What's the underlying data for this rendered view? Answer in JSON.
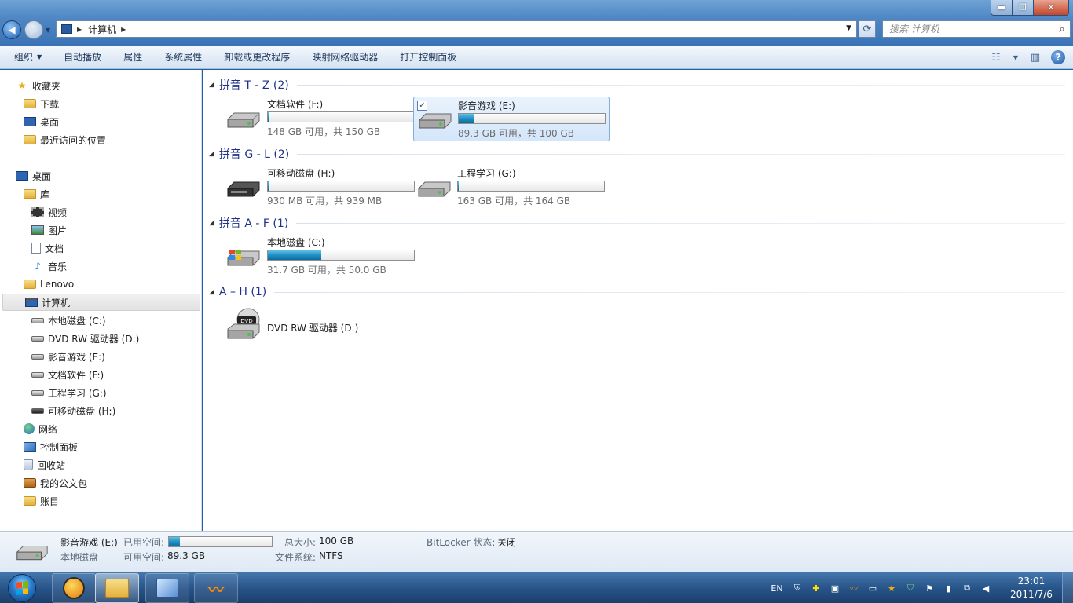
{
  "window": {
    "title_buttons": {
      "minimize": "▬",
      "maximize": "❐",
      "close": "✕"
    }
  },
  "address": {
    "crumb": "计算机"
  },
  "search": {
    "placeholder": "搜索 计算机"
  },
  "toolbar": {
    "organize": "组织",
    "autoplay": "自动播放",
    "properties": "属性",
    "system_properties": "系统属性",
    "uninstall": "卸载或更改程序",
    "map_drive": "映射网络驱动器",
    "control_panel": "打开控制面板"
  },
  "nav": {
    "favorites": "收藏夹",
    "downloads": "下载",
    "desktop_fav": "桌面",
    "recent": "最近访问的位置",
    "desktop": "桌面",
    "libraries": "库",
    "videos": "视频",
    "pictures": "图片",
    "documents": "文档",
    "music": "音乐",
    "lenovo": "Lenovo",
    "computer": "计算机",
    "drive_c": "本地磁盘 (C:)",
    "drive_d": "DVD RW 驱动器 (D:)",
    "drive_e": "影音游戏 (E:)",
    "drive_f": "文档软件 (F:)",
    "drive_g": "工程学习 (G:)",
    "drive_h": "可移动磁盘 (H:)",
    "network": "网络",
    "control_panel": "控制面板",
    "recycle_bin": "回收站",
    "briefcase": "我的公文包",
    "ledger": "账目"
  },
  "groups": [
    {
      "title": "拼音 T - Z (2)"
    },
    {
      "title": "拼音 G - L (2)"
    },
    {
      "title": "拼音 A - F (1)"
    },
    {
      "title": "A – H (1)"
    }
  ],
  "drives": {
    "f": {
      "name": "文档软件 (F:)",
      "space": "148 GB 可用，共 150 GB",
      "used_fraction": 0.013
    },
    "e": {
      "name": "影音游戏 (E:)",
      "space": "89.3 GB 可用，共 100 GB",
      "used_fraction": 0.107
    },
    "h": {
      "name": "可移动磁盘 (H:)",
      "space": "930 MB 可用，共 939 MB",
      "used_fraction": 0.01
    },
    "g": {
      "name": "工程学习 (G:)",
      "space": "163 GB 可用，共 164 GB",
      "used_fraction": 0.006
    },
    "c": {
      "name": "本地磁盘 (C:)",
      "space": "31.7 GB 可用，共 50.0 GB",
      "used_fraction": 0.366
    },
    "d": {
      "name": "DVD RW 驱动器 (D:)"
    }
  },
  "details": {
    "name": "影音游戏 (E:)",
    "type": "本地磁盘",
    "used_label": "已用空间:",
    "free_label": "可用空间:",
    "free_value": "89.3 GB",
    "total_label": "总大小:",
    "total_value": "100 GB",
    "fs_label": "文件系统:",
    "fs_value": "NTFS",
    "bitlocker_label": "BitLocker 状态:",
    "bitlocker_value": "关闭",
    "used_fraction": 0.107
  },
  "taskbar": {
    "lang": "EN",
    "time": "23:01",
    "date": "2011/7/6"
  },
  "colors": {
    "accent": "#1e3287",
    "bar_fill": "#1f8fc4",
    "selection": "#d4e6fa"
  }
}
